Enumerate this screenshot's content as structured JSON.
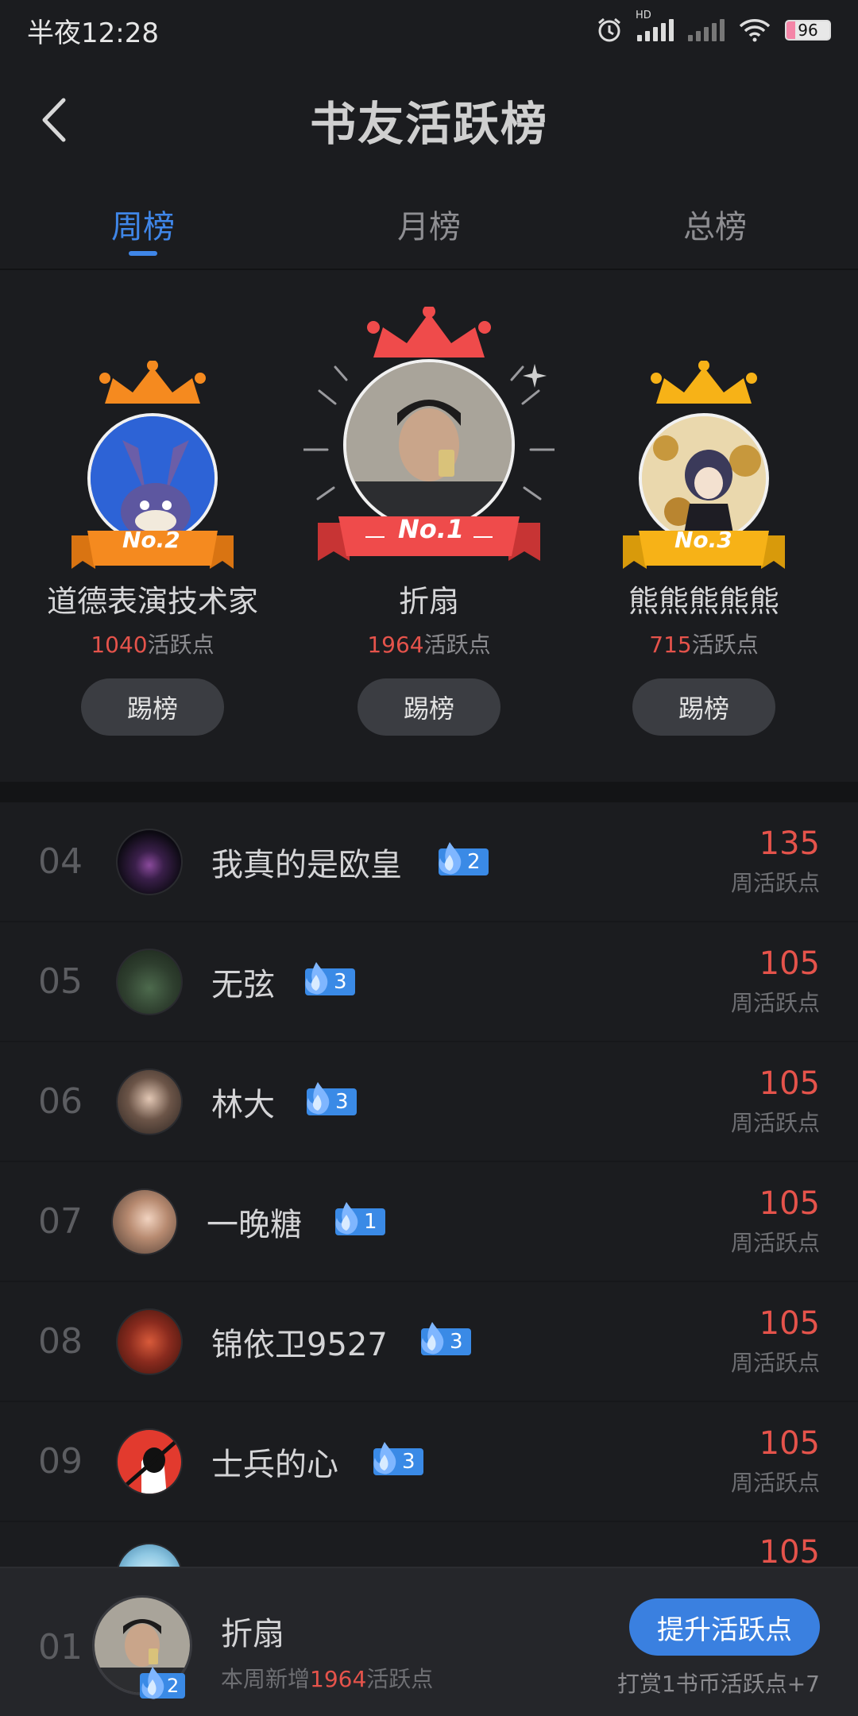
{
  "status_bar": {
    "time": "半夜12:28",
    "battery": "96",
    "hd_label": "HD"
  },
  "header": {
    "title": "书友活跃榜"
  },
  "tabs": [
    {
      "label": "周榜",
      "active": true
    },
    {
      "label": "月榜",
      "active": false
    },
    {
      "label": "总榜",
      "active": false
    }
  ],
  "podium": {
    "first": {
      "rank_label": "No.1",
      "name": "折扇",
      "points": "1964",
      "points_suffix": "活跃点",
      "button": "踢榜"
    },
    "second": {
      "rank_label": "No.2",
      "name": "道德表演技术家",
      "points": "1040",
      "points_suffix": "活跃点",
      "button": "踢榜"
    },
    "third": {
      "rank_label": "No.3",
      "name": "熊熊熊熊熊",
      "points": "715",
      "points_suffix": "活跃点",
      "button": "踢榜"
    }
  },
  "list": [
    {
      "rank": "04",
      "name": "我真的是欧皇",
      "level": "2",
      "score": "135",
      "score_label": "周活跃点"
    },
    {
      "rank": "05",
      "name": "无弦",
      "level": "3",
      "score": "105",
      "score_label": "周活跃点"
    },
    {
      "rank": "06",
      "name": "林大",
      "level": "3",
      "score": "105",
      "score_label": "周活跃点"
    },
    {
      "rank": "07",
      "name": "一晚糖",
      "level": "1",
      "score": "105",
      "score_label": "周活跃点"
    },
    {
      "rank": "08",
      "name": "锦依卫9527",
      "level": "3",
      "score": "105",
      "score_label": "周活跃点"
    },
    {
      "rank": "09",
      "name": "士兵的心",
      "level": "3",
      "score": "105",
      "score_label": "周活跃点"
    },
    {
      "rank": "",
      "name": "",
      "level": "",
      "score": "105",
      "score_label": ""
    }
  ],
  "me": {
    "rank": "01",
    "name": "折扇",
    "level": "2",
    "desc_prefix": "本周新增",
    "desc_points": "1964",
    "desc_suffix": "活跃点",
    "button": "提升活跃点",
    "tip": "打赏1书币活跃点+7"
  },
  "colors": {
    "accent": "#3f86e8",
    "score": "#e5534b",
    "gold": "#f7b217",
    "orange": "#f58a1f",
    "red_ribbon": "#ef4b4b"
  }
}
